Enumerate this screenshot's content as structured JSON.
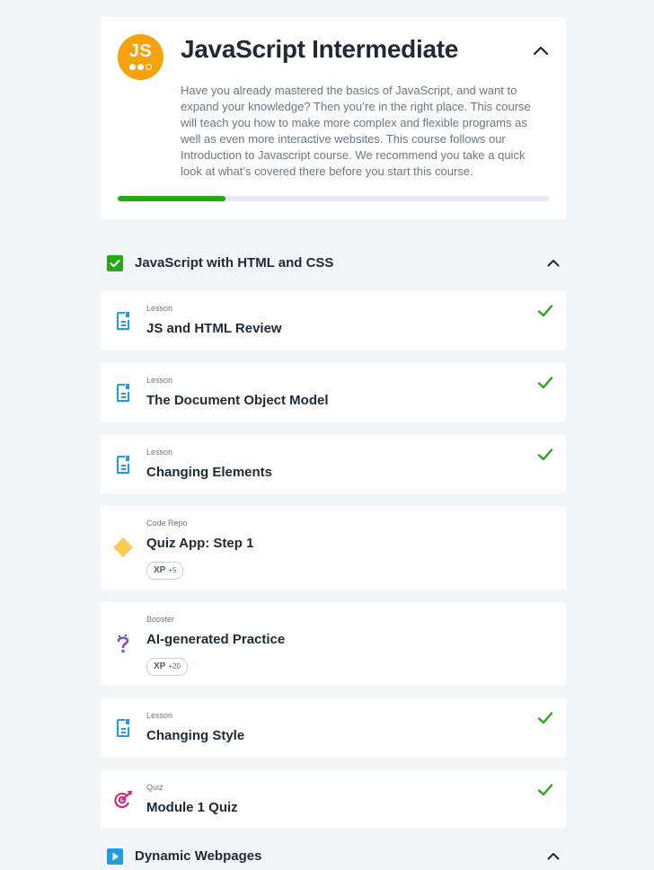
{
  "course": {
    "logo_text": "JS",
    "title": "JavaScript Intermediate",
    "description": "Have you already mastered the basics of JavaScript, and want to expand your knowledge? Then you’re in the right place. This course will teach you how to make more complex and flexible programs as well as even more interactive websites. This course follows our Introduction to Javascript course. We recommend you take a quick look at what’s covered there before you start this course.",
    "progress": 0.25,
    "accent_color": "#f7a20c",
    "progress_color": "#26a816"
  },
  "modules": [
    {
      "title": "JavaScript with HTML and CSS",
      "status": "completed",
      "status_color": "#26a816",
      "items": [
        {
          "type": "Lesson",
          "title": "JS and HTML Review",
          "icon": "lesson-icon",
          "completed": true
        },
        {
          "type": "Lesson",
          "title": "The Document Object Model",
          "icon": "lesson-icon",
          "completed": true
        },
        {
          "type": "Lesson",
          "title": "Changing Elements",
          "icon": "lesson-icon",
          "completed": true
        },
        {
          "type": "Code Repo",
          "title": "Quiz App: Step 1",
          "icon": "code-repo-icon",
          "completed": false,
          "xp_label": "XP",
          "xp_points": "+5"
        },
        {
          "type": "Booster",
          "title": "AI-generated Practice",
          "icon": "booster-icon",
          "completed": false,
          "xp_label": "XP",
          "xp_points": "+20"
        },
        {
          "type": "Lesson",
          "title": "Changing Style",
          "icon": "lesson-icon",
          "completed": true
        },
        {
          "type": "Quiz",
          "title": "Module 1 Quiz",
          "icon": "quiz-icon",
          "completed": true
        }
      ]
    },
    {
      "title": "Dynamic Webpages",
      "status": "in-progress",
      "status_color": "#1e9ce8"
    }
  ]
}
